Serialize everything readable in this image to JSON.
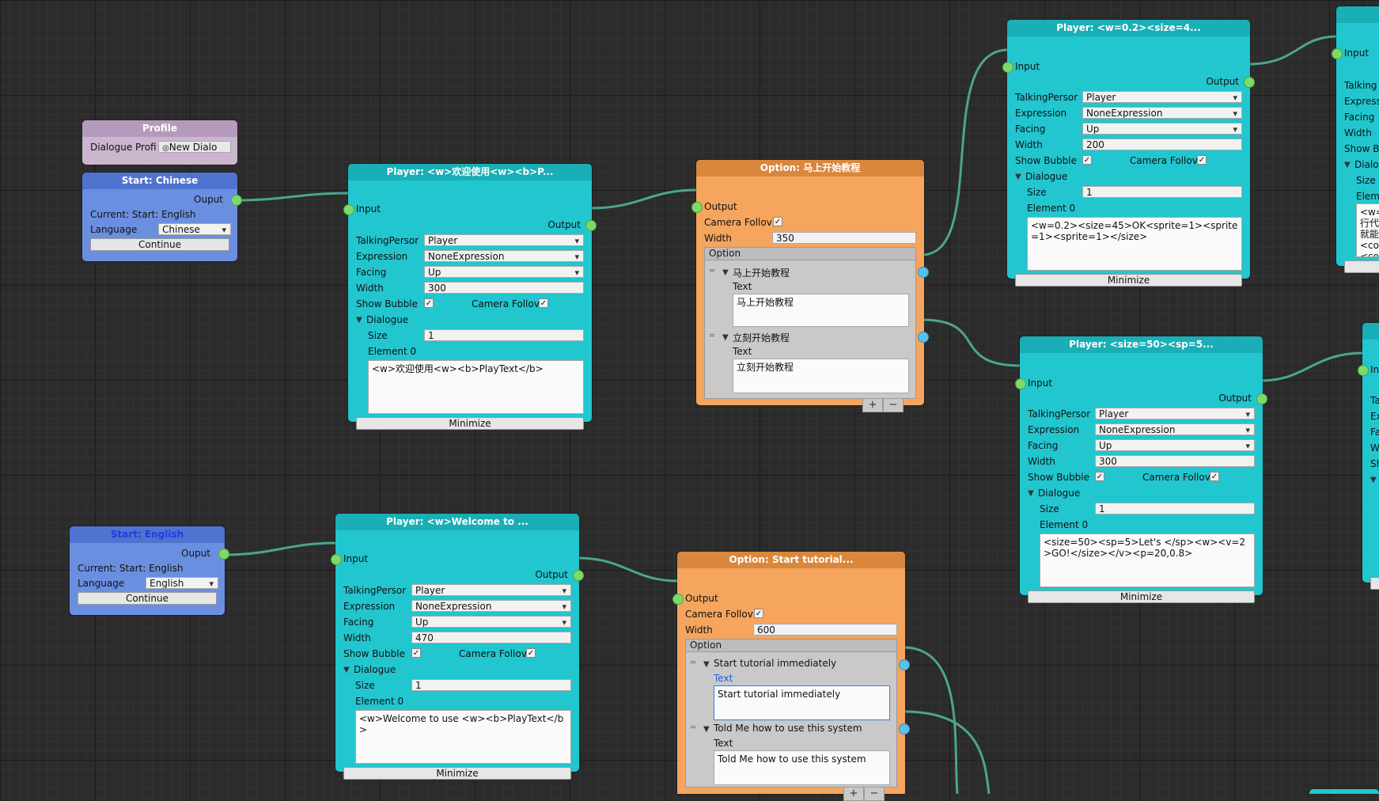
{
  "colors": {
    "canvas": "#2b2b2b",
    "player": "#22c6cf",
    "player_header": "#1aaeb6",
    "option": "#f5a55e",
    "option_header": "#d9873c",
    "start": "#6b8fe0",
    "start_header": "#4f73cf",
    "profile": "#cbb5cf",
    "profile_header": "#b59bbb",
    "wire": "#4ca58c"
  },
  "profile": {
    "title": "Profile",
    "label": "Dialogue Profi",
    "value": "New Dialo"
  },
  "start_cn": {
    "title": "Start: Chinese",
    "output": "Ouput",
    "current": "Current: Start: English",
    "language_label": "Language",
    "language": "Chinese",
    "continue": "Continue"
  },
  "start_en": {
    "title": "Start: English",
    "output": "Ouput",
    "current": "Current: Start: English",
    "language_label": "Language",
    "language": "English",
    "continue": "Continue"
  },
  "labels": {
    "input": "Input",
    "output": "Output",
    "talking": "TalkingPersor",
    "expression": "Expression",
    "facing": "Facing",
    "width": "Width",
    "show_bubble": "Show Bubble",
    "camera": "Camera Follov",
    "dialogue": "Dialogue",
    "size": "Size",
    "element0": "Element 0",
    "minimize": "Minimize",
    "option": "Option",
    "text": "Text",
    "plus": "+",
    "minus": "−"
  },
  "player_cn": {
    "title": "Player: <w>欢迎使用<w><b>P...",
    "talking": "Player",
    "expression": "NoneExpression",
    "facing": "Up",
    "width": "300",
    "size": "1",
    "element0": "<w>欢迎使用<w><b>PlayText</b>"
  },
  "player_en": {
    "title": "Player: <w>Welcome to ...",
    "talking": "Player",
    "expression": "NoneExpression",
    "facing": "Up",
    "width": "470",
    "size": "1",
    "element0": "<w>Welcome to use <w><b>PlayText</b>"
  },
  "option_cn": {
    "title": "Option: 马上开始教程",
    "width": "350",
    "options": [
      {
        "name": "马上开始教程",
        "text": "马上开始教程"
      },
      {
        "name": "立刻开始教程",
        "text": "立刻开始教程"
      }
    ]
  },
  "option_en": {
    "title": "Option: Start tutorial...",
    "width": "600",
    "options": [
      {
        "name": "Start tutorial immediately",
        "text": "Start tutorial immediately"
      },
      {
        "name": "Told Me how to use this system",
        "text": "Told Me how to use this system"
      }
    ]
  },
  "player_r1": {
    "title": "Player: <w=0.2><size=4...",
    "talking": "Player",
    "expression": "NoneExpression",
    "facing": "Up",
    "width": "200",
    "size": "1",
    "element0": "<w=0.2><size=45>OK<sprite=1><sprite=1><sprite=1></size>"
  },
  "player_r2": {
    "title": "Player: <size=50><sp=5...",
    "talking": "Player",
    "expression": "NoneExpression",
    "facing": "Up",
    "width": "300",
    "size": "1",
    "element0": "<size=50><sp=5>Let's </sp><w><v=2>GO!</size></v><p=20,0.8>"
  },
  "partial_r1": {
    "input": "Input",
    "talking": "Talking",
    "expression": "Express",
    "facing": "Facing",
    "width": "Width",
    "show_bubble": "Show B",
    "dialogue": "Dialo",
    "size": "Size",
    "element": "Elem",
    "element0": "<w=\n行代码\n就能让\n<colo\n<colo"
  },
  "partial_r2": {
    "input": "Inp",
    "talking": "Ta",
    "expression": "Ex",
    "facing": "Fa",
    "width": "W",
    "show_bubble": "Sh"
  }
}
